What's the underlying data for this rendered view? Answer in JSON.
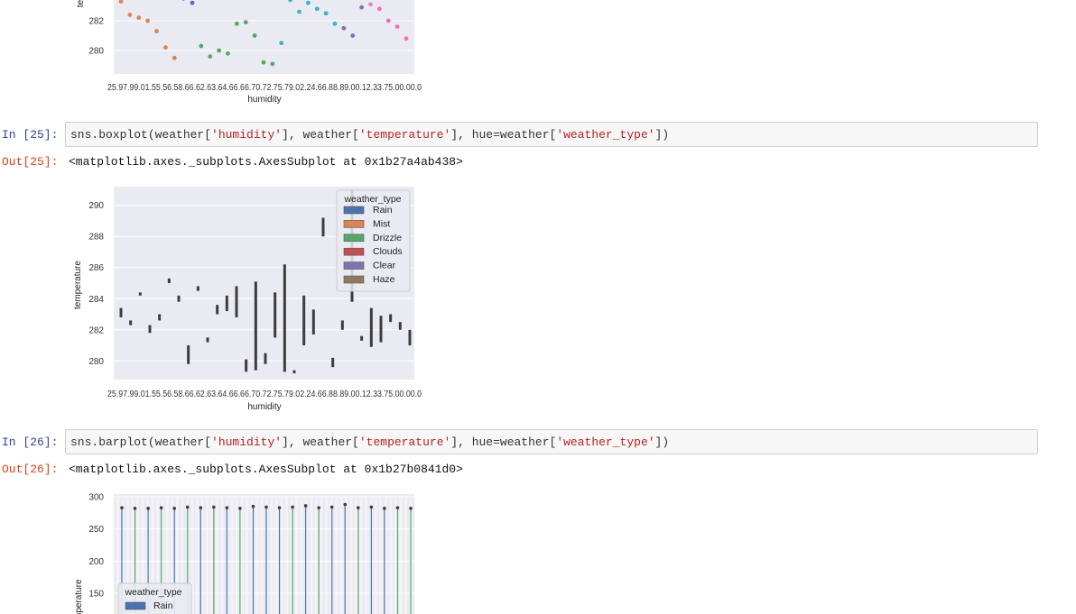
{
  "cells": [
    {
      "in_label": "In [25]:",
      "code": {
        "func": "sns.boxplot(weather[",
        "s1": "'humidity'",
        "mid1": "], weather[",
        "s2": "'temperature'",
        "mid2": "], hue=weather[",
        "s3": "'weather_type'",
        "end": "])"
      },
      "out_label": "Out[25]:",
      "out_text": "<matplotlib.axes._subplots.AxesSubplot at 0x1b27a4ab438>"
    },
    {
      "in_label": "In [26]:",
      "code": {
        "func": "sns.barplot(weather[",
        "s1": "'humidity'",
        "mid1": "], weather[",
        "s2": "'temperature'",
        "mid2": "], hue=weather[",
        "s3": "'weather_type'",
        "end": "])"
      },
      "out_label": "Out[26]:",
      "out_text": "<matplotlib.axes._subplots.AxesSubplot at 0x1b27b0841d0>"
    }
  ],
  "colors": {
    "Rain": "#4c72b0",
    "Mist": "#dd8452",
    "Drizzle": "#55a868",
    "Clouds": "#c44e52",
    "Clear": "#8172b3",
    "Haze": "#937860",
    "extra1": "#da8bc3",
    "extra2": "#ff69b4",
    "extra3": "#3cb4c4",
    "axes_bg": "#eaeaf2",
    "box_dark": "#3d3d3d"
  },
  "chart_data": [
    {
      "type": "scatter",
      "title": "",
      "xlabel": "humidity",
      "ylabel": "te",
      "y_ticks": [
        280,
        282
      ],
      "x_tick_text": "25.97.99.01.55.56.58.66.62.63.64.66.66.70.72.75.79.02.24.66.88.89.00.12.33.75.00.00.0",
      "points": [
        {
          "x": 0,
          "y": 283.3,
          "series": "Mist"
        },
        {
          "x": 1,
          "y": 282.4,
          "series": "Mist"
        },
        {
          "x": 2,
          "y": 282.2,
          "series": "Mist"
        },
        {
          "x": 3,
          "y": 282.0,
          "series": "Mist"
        },
        {
          "x": 4,
          "y": 281.3,
          "series": "Mist"
        },
        {
          "x": 5,
          "y": 280.2,
          "series": "Mist"
        },
        {
          "x": 6,
          "y": 279.5,
          "series": "Mist"
        },
        {
          "x": 7,
          "y": 283.5,
          "series": "Rain"
        },
        {
          "x": 8,
          "y": 283.2,
          "series": "Rain"
        },
        {
          "x": 9,
          "y": 280.3,
          "series": "Drizzle"
        },
        {
          "x": 10,
          "y": 279.6,
          "series": "Drizzle"
        },
        {
          "x": 11,
          "y": 280.0,
          "series": "Drizzle"
        },
        {
          "x": 12,
          "y": 279.8,
          "series": "Drizzle"
        },
        {
          "x": 13,
          "y": 281.8,
          "series": "Drizzle"
        },
        {
          "x": 14,
          "y": 281.9,
          "series": "Drizzle"
        },
        {
          "x": 15,
          "y": 281.0,
          "series": "Drizzle"
        },
        {
          "x": 16,
          "y": 279.2,
          "series": "Drizzle"
        },
        {
          "x": 17,
          "y": 279.1,
          "series": "Drizzle"
        },
        {
          "x": 18,
          "y": 280.5,
          "series": "extra3"
        },
        {
          "x": 19,
          "y": 283.4,
          "series": "extra3"
        },
        {
          "x": 20,
          "y": 282.6,
          "series": "extra3"
        },
        {
          "x": 21,
          "y": 283.2,
          "series": "extra3"
        },
        {
          "x": 22,
          "y": 282.8,
          "series": "extra3"
        },
        {
          "x": 23,
          "y": 282.5,
          "series": "extra3"
        },
        {
          "x": 24,
          "y": 281.8,
          "series": "extra3"
        },
        {
          "x": 25,
          "y": 281.5,
          "series": "Clear"
        },
        {
          "x": 26,
          "y": 281.0,
          "series": "Clear"
        },
        {
          "x": 27,
          "y": 282.9,
          "series": "Clear"
        },
        {
          "x": 28,
          "y": 283.1,
          "series": "extra1"
        },
        {
          "x": 29,
          "y": 282.8,
          "series": "extra2"
        },
        {
          "x": 30,
          "y": 282.0,
          "series": "extra2"
        },
        {
          "x": 31,
          "y": 281.6,
          "series": "extra2"
        },
        {
          "x": 32,
          "y": 280.8,
          "series": "extra2"
        }
      ]
    },
    {
      "type": "box",
      "title": "",
      "xlabel": "humidity",
      "ylabel": "temperature",
      "ylim": [
        278.8,
        291.2
      ],
      "y_ticks": [
        280,
        282,
        284,
        286,
        288,
        290
      ],
      "x_tick_text": "25.97.99.01.55.56.58.66.62.63.64.66.66.70.72.75.79.02.24.66.88.89.00.12.33.75.00.00.0",
      "legend_title": "weather_type",
      "legend_position": "upper right",
      "legend": [
        "Rain",
        "Mist",
        "Drizzle",
        "Clouds",
        "Clear",
        "Haze"
      ],
      "boxes": [
        {
          "x": 0,
          "low": 282.8,
          "high": 283.4
        },
        {
          "x": 1,
          "low": 282.3,
          "high": 282.6
        },
        {
          "x": 2,
          "low": 284.2,
          "high": 284.4
        },
        {
          "x": 3,
          "low": 281.8,
          "high": 282.3
        },
        {
          "x": 4,
          "low": 282.6,
          "high": 283.0
        },
        {
          "x": 5,
          "low": 285.0,
          "high": 285.3
        },
        {
          "x": 6,
          "low": 283.8,
          "high": 284.2
        },
        {
          "x": 7,
          "low": 279.8,
          "high": 281.0
        },
        {
          "x": 8,
          "low": 284.5,
          "high": 284.8
        },
        {
          "x": 9,
          "low": 281.2,
          "high": 281.5
        },
        {
          "x": 10,
          "low": 283.0,
          "high": 283.6
        },
        {
          "x": 11,
          "low": 283.2,
          "high": 284.2
        },
        {
          "x": 12,
          "low": 282.8,
          "high": 284.8
        },
        {
          "x": 13,
          "low": 279.3,
          "high": 280.1
        },
        {
          "x": 14,
          "low": 279.4,
          "high": 285.1
        },
        {
          "x": 15,
          "low": 279.8,
          "high": 280.5
        },
        {
          "x": 16,
          "low": 281.5,
          "high": 284.4
        },
        {
          "x": 17,
          "low": 279.3,
          "high": 286.2
        },
        {
          "x": 18,
          "low": 279.2,
          "high": 279.4
        },
        {
          "x": 19,
          "low": 281.0,
          "high": 284.2
        },
        {
          "x": 20,
          "low": 281.7,
          "high": 283.3
        },
        {
          "x": 21,
          "low": 288.0,
          "high": 289.2
        },
        {
          "x": 22,
          "low": 279.6,
          "high": 280.2
        },
        {
          "x": 23,
          "low": 282.0,
          "high": 282.6
        },
        {
          "x": 24,
          "low": 283.8,
          "high": 291.0
        },
        {
          "x": 25,
          "low": 281.3,
          "high": 281.6
        },
        {
          "x": 26,
          "low": 280.9,
          "high": 283.4
        },
        {
          "x": 27,
          "low": 281.2,
          "high": 282.9
        },
        {
          "x": 28,
          "low": 282.5,
          "high": 283.0
        },
        {
          "x": 29,
          "low": 282.0,
          "high": 282.5
        },
        {
          "x": 30,
          "low": 281.0,
          "high": 282.0
        }
      ]
    },
    {
      "type": "bar",
      "title": "",
      "xlabel": "",
      "ylabel": "emperature",
      "ylim": [
        130,
        305
      ],
      "y_ticks": [
        150,
        200,
        250,
        300
      ],
      "legend_title": "weather_type",
      "legend": [
        "Rain"
      ],
      "bars": [
        {
          "x": 0,
          "value": 283,
          "series": "Rain"
        },
        {
          "x": 1,
          "value": 282,
          "series": "Drizzle"
        },
        {
          "x": 2,
          "value": 282,
          "series": "Rain"
        },
        {
          "x": 3,
          "value": 283,
          "series": "Drizzle"
        },
        {
          "x": 4,
          "value": 282,
          "series": "Rain"
        },
        {
          "x": 5,
          "value": 284,
          "series": "Drizzle"
        },
        {
          "x": 6,
          "value": 283,
          "series": "Rain"
        },
        {
          "x": 7,
          "value": 284,
          "series": "Drizzle"
        },
        {
          "x": 8,
          "value": 283,
          "series": "Rain"
        },
        {
          "x": 9,
          "value": 282,
          "series": "Drizzle"
        },
        {
          "x": 10,
          "value": 285,
          "series": "Rain"
        },
        {
          "x": 11,
          "value": 284,
          "series": "Rain"
        },
        {
          "x": 12,
          "value": 283,
          "series": "Rain"
        },
        {
          "x": 13,
          "value": 284,
          "series": "Drizzle"
        },
        {
          "x": 14,
          "value": 286,
          "series": "Rain"
        },
        {
          "x": 15,
          "value": 283,
          "series": "Drizzle"
        },
        {
          "x": 16,
          "value": 284,
          "series": "Rain"
        },
        {
          "x": 17,
          "value": 288,
          "series": "Rain"
        },
        {
          "x": 18,
          "value": 283,
          "series": "Drizzle"
        },
        {
          "x": 19,
          "value": 284,
          "series": "Rain"
        },
        {
          "x": 20,
          "value": 282,
          "series": "Rain"
        },
        {
          "x": 21,
          "value": 283,
          "series": "Drizzle"
        },
        {
          "x": 22,
          "value": 282,
          "series": "Drizzle"
        }
      ]
    }
  ]
}
